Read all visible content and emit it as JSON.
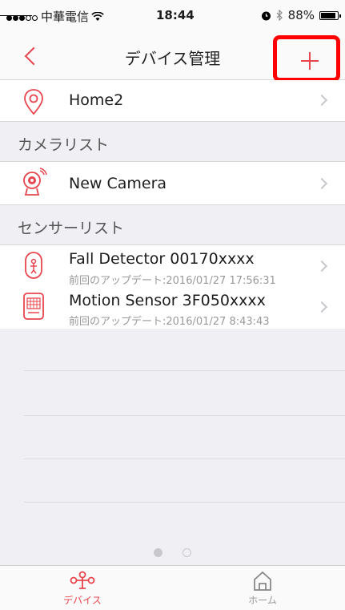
{
  "status_bar": {
    "carrier": "中華電信",
    "time": "18:44",
    "battery": "88%",
    "battery_level": 0.88
  },
  "nav": {
    "title": "デバイス管理",
    "back_icon": "chevron-left-icon",
    "add_icon": "plus-icon"
  },
  "home_row": {
    "label": "Home2",
    "icon": "location-pin-icon"
  },
  "camera_section": {
    "header": "カメラリスト",
    "items": [
      {
        "label": "New Camera",
        "icon": "camera-icon"
      }
    ]
  },
  "sensor_section": {
    "header": "センサーリスト",
    "items": [
      {
        "label": "Fall Detector 00170xxxx",
        "sub": "前回のアップデート:2016/01/27 17:56:31",
        "icon": "fall-detector-icon"
      },
      {
        "label": "Motion Sensor 3F050xxxx",
        "sub": "前回のアップデート:2016/01/27 8:43:43",
        "icon": "motion-sensor-icon"
      }
    ]
  },
  "pager": {
    "current_page": 1,
    "total_pages": 2
  },
  "tab_bar": {
    "tabs": [
      {
        "label": "デバイス",
        "icon": "devices-icon",
        "active": true
      },
      {
        "label": "ホーム",
        "icon": "home-icon",
        "active": false
      }
    ]
  },
  "colors": {
    "accent": "#e8454e",
    "highlight_box": "#ff0000"
  }
}
